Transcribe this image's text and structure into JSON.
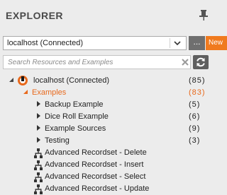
{
  "panel": {
    "title": "EXPLORER"
  },
  "connection": {
    "selected": "localhost (Connected)",
    "more_label": "...",
    "new_label": "New"
  },
  "search": {
    "placeholder": "Search Resources and Examples"
  },
  "tree": {
    "root": {
      "label": "localhost (Connected)",
      "count": "(85)"
    },
    "examples": {
      "label": "Examples",
      "count": "(83)"
    },
    "folders": [
      {
        "label": "Backup Example",
        "count": "(5)"
      },
      {
        "label": "Dice Roll Example",
        "count": "(6)"
      },
      {
        "label": "Example Sources",
        "count": "(9)"
      },
      {
        "label": "Testing",
        "count": "(3)"
      }
    ],
    "items": [
      {
        "label": "Advanced Recordset - Delete"
      },
      {
        "label": "Advanced Recordset - Insert"
      },
      {
        "label": "Advanced Recordset - Select"
      },
      {
        "label": "Advanced Recordset - Update"
      }
    ]
  },
  "colors": {
    "accent": "#f07a1e",
    "tree_orange": "#e8691c",
    "panel_bg": "#ececec"
  }
}
